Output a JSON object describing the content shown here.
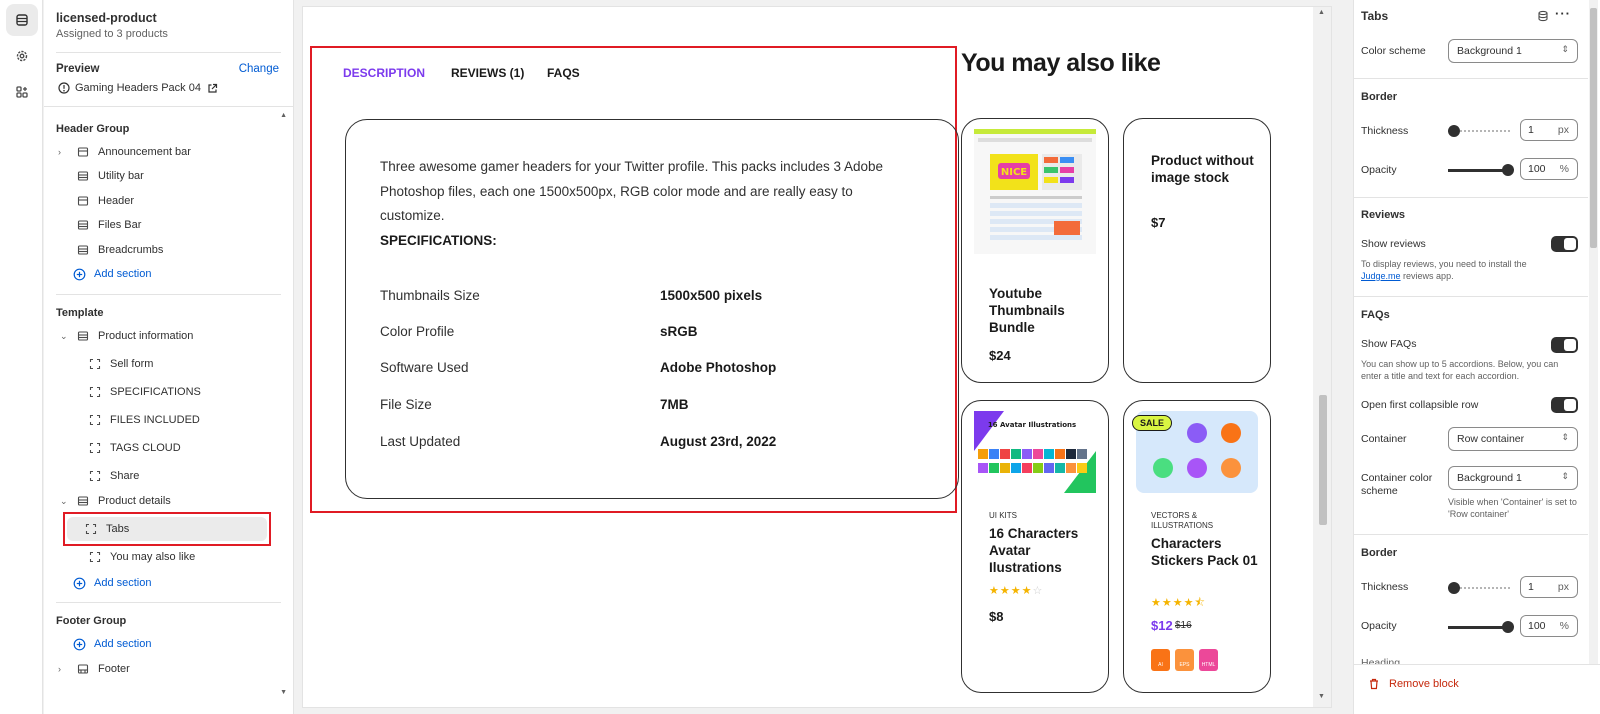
{
  "left_panel": {
    "title": "licensed-product",
    "subtitle": "Assigned to 3 products",
    "preview_label": "Preview",
    "change_label": "Change",
    "preview_product": "Gaming Headers Pack 04",
    "header_group": {
      "title": "Header Group",
      "items": [
        "Announcement bar",
        "Utility bar",
        "Header",
        "Files Bar",
        "Breadcrumbs"
      ],
      "add_label": "Add section"
    },
    "template": {
      "title": "Template",
      "product_information": "Product information",
      "pi_items": [
        "Sell form",
        "SPECIFICATIONS",
        "FILES INCLUDED",
        "TAGS CLOUD",
        "Share"
      ],
      "product_details": "Product details",
      "pd_items": [
        "Tabs",
        "You may also like"
      ],
      "add_label": "Add section"
    },
    "footer_group": {
      "title": "Footer Group",
      "add_label": "Add section",
      "footer": "Footer"
    }
  },
  "preview": {
    "tabs": [
      "DESCRIPTION",
      "REVIEWS (1)",
      "FAQS"
    ],
    "description": "Three awesome gamer headers for your Twitter profile. This packs includes 3 Adobe Photoshop files, each one 1500x500px, RGB color mode and are really easy to customize.",
    "spec_heading": "SPECIFICATIONS:",
    "specs": [
      {
        "label": "Thumbnails Size",
        "value": "1500x500 pixels"
      },
      {
        "label": "Color Profile",
        "value": "sRGB"
      },
      {
        "label": "Software Used",
        "value": "Adobe Photoshop"
      },
      {
        "label": "File Size",
        "value": "7MB"
      },
      {
        "label": "Last Updated",
        "value": "August 23rd, 2022"
      }
    ],
    "ymal_title": "You may also like",
    "products": [
      {
        "title": "Youtube Thumbnails Bundle",
        "price": "$24"
      },
      {
        "title": "Product without image stock",
        "price": "$7"
      },
      {
        "category": "UI KITS",
        "title": "16 Characters Avatar Ilustrations",
        "price": "$8",
        "rating": 4
      },
      {
        "category": "VECTORS & ILLUSTRATIONS",
        "title": "Characters Stickers Pack 01",
        "price": "$12",
        "compare_price": "$16",
        "rating": 4.5,
        "badge": "SALE",
        "file_types": [
          "AI",
          "EPS",
          "HTML"
        ]
      }
    ],
    "thumb_texts": {
      "nice": "NICE",
      "avatar_title": "16 Avatar Illustrations"
    }
  },
  "right_panel": {
    "title": "Tabs",
    "color_scheme_label": "Color scheme",
    "color_scheme_value": "Background 1",
    "border1": {
      "title": "Border",
      "thickness_label": "Thickness",
      "thickness": "1",
      "thickness_unit": "px",
      "opacity_label": "Opacity",
      "opacity": "100",
      "opacity_unit": "%"
    },
    "reviews": {
      "title": "Reviews",
      "show_label": "Show reviews",
      "help_prefix": "To display reviews, you need to install the",
      "help_link": "Judge.me",
      "help_suffix": "reviews app."
    },
    "faqs": {
      "title": "FAQs",
      "show_label": "Show FAQs",
      "help": "You can show up to 5 accordions. Below, you can enter a title and text for each accordion.",
      "open_first_label": "Open first collapsible row"
    },
    "container_label": "Container",
    "container_value": "Row container",
    "container_color_label": "Container color scheme",
    "container_color_value": "Background 1",
    "container_color_help": "Visible when 'Container' is set to 'Row container'",
    "border2": {
      "title": "Border",
      "thickness_label": "Thickness",
      "thickness": "1",
      "thickness_unit": "px",
      "opacity_label": "Opacity",
      "opacity": "100",
      "opacity_unit": "%"
    },
    "next_heading": "Heading",
    "remove_label": "Remove block"
  },
  "colors": {
    "accent": "#7c3aed",
    "highlight": "#e01b24",
    "link": "#005bd3",
    "price_sale": "#7c3aed"
  },
  "icons": [
    "sections-icon",
    "gear-icon",
    "apps-icon",
    "info-icon",
    "external-link-icon",
    "section-icon",
    "block-icon",
    "plus-circle-icon",
    "chevron-right-icon",
    "chevron-down-icon",
    "database-icon",
    "more-icon",
    "trash-icon"
  ]
}
